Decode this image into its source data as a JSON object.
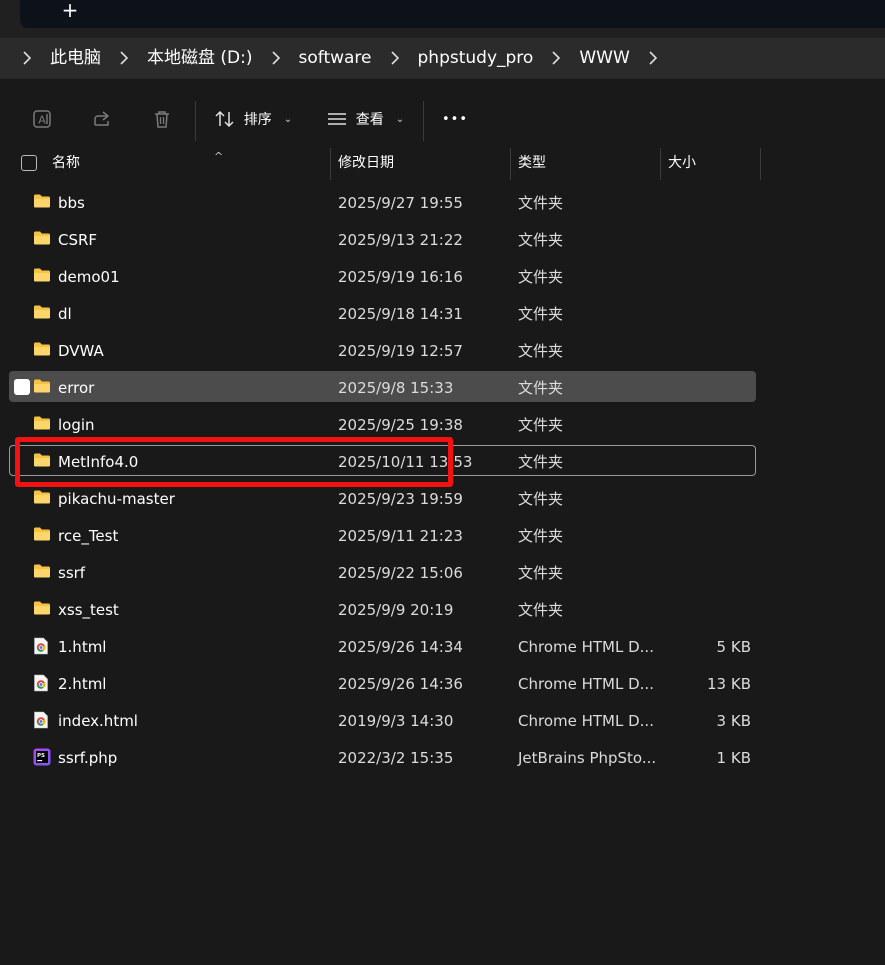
{
  "tabstrip": {
    "new_tab_label": "+"
  },
  "breadcrumb": [
    "此电脑",
    "本地磁盘 (D:)",
    "software",
    "phpstudy_pro",
    "WWW"
  ],
  "commandbar": {
    "sort_label": "排序",
    "view_label": "查看",
    "more_label": "•••"
  },
  "columns": {
    "name": "名称",
    "modified": "修改日期",
    "type": "类型",
    "size": "大小"
  },
  "files": [
    {
      "name": "bbs",
      "modified": "2025/9/27 19:55",
      "type": "文件夹",
      "size": "",
      "icon": "folder-icon"
    },
    {
      "name": "CSRF",
      "modified": "2025/9/13 21:22",
      "type": "文件夹",
      "size": "",
      "icon": "folder-icon"
    },
    {
      "name": "demo01",
      "modified": "2025/9/19 16:16",
      "type": "文件夹",
      "size": "",
      "icon": "folder-icon"
    },
    {
      "name": "dl",
      "modified": "2025/9/18 14:31",
      "type": "文件夹",
      "size": "",
      "icon": "folder-icon"
    },
    {
      "name": "DVWA",
      "modified": "2025/9/19 12:57",
      "type": "文件夹",
      "size": "",
      "icon": "folder-icon"
    },
    {
      "name": "error",
      "modified": "2025/9/8 15:33",
      "type": "文件夹",
      "size": "",
      "icon": "folder-icon"
    },
    {
      "name": "login",
      "modified": "2025/9/25 19:38",
      "type": "文件夹",
      "size": "",
      "icon": "folder-icon"
    },
    {
      "name": "MetInfo4.0",
      "modified": "2025/10/11 13:53",
      "type": "文件夹",
      "size": "",
      "icon": "folder-icon"
    },
    {
      "name": "pikachu-master",
      "modified": "2025/9/23 19:59",
      "type": "文件夹",
      "size": "",
      "icon": "folder-icon"
    },
    {
      "name": "rce_Test",
      "modified": "2025/9/11 21:23",
      "type": "文件夹",
      "size": "",
      "icon": "folder-icon"
    },
    {
      "name": "ssrf",
      "modified": "2025/9/22 15:06",
      "type": "文件夹",
      "size": "",
      "icon": "folder-icon"
    },
    {
      "name": "xss_test",
      "modified": "2025/9/9 20:19",
      "type": "文件夹",
      "size": "",
      "icon": "folder-icon"
    },
    {
      "name": "1.html",
      "modified": "2025/9/26 14:34",
      "type": "Chrome HTML D...",
      "size": "5 KB",
      "icon": "chrome-html-icon"
    },
    {
      "name": "2.html",
      "modified": "2025/9/26 14:36",
      "type": "Chrome HTML D...",
      "size": "13 KB",
      "icon": "chrome-html-icon"
    },
    {
      "name": "index.html",
      "modified": "2019/9/3 14:30",
      "type": "Chrome HTML D...",
      "size": "3 KB",
      "icon": "chrome-html-icon"
    },
    {
      "name": "ssrf.php",
      "modified": "2022/3/2 15:35",
      "type": "JetBrains PhpSto...",
      "size": "1 KB",
      "icon": "phpstorm-icon"
    }
  ],
  "state": {
    "hovered_row": "error",
    "focused_row": "MetInfo4.0"
  },
  "colors": {
    "folder": "#f6c244",
    "annotation": "#f21212",
    "hover": "#4c4c4c"
  }
}
